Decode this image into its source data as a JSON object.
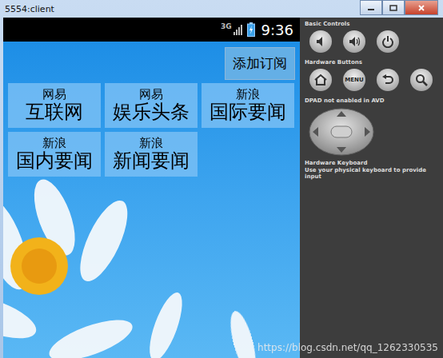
{
  "window": {
    "title": "5554:client"
  },
  "status_bar": {
    "network": "3G",
    "time": "9:36"
  },
  "add_button": "添加订阅",
  "subscriptions": [
    {
      "source": "网易",
      "name": "互联网"
    },
    {
      "source": "网易",
      "name": "娱乐头条"
    },
    {
      "source": "新浪",
      "name": "国际要闻"
    },
    {
      "source": "新浪",
      "name": "国内要闻"
    },
    {
      "source": "新浪",
      "name": "新闻要闻"
    }
  ],
  "controls": {
    "basic_title": "Basic Controls",
    "hardware_title": "Hardware Buttons",
    "menu_label": "MENU",
    "dpad_note": "DPAD not enabled in AVD",
    "keyboard_title": "Hardware Keyboard",
    "keyboard_note": "Use your physical keyboard to provide input"
  },
  "watermark": "https://blog.csdn.net/qq_1262330535"
}
